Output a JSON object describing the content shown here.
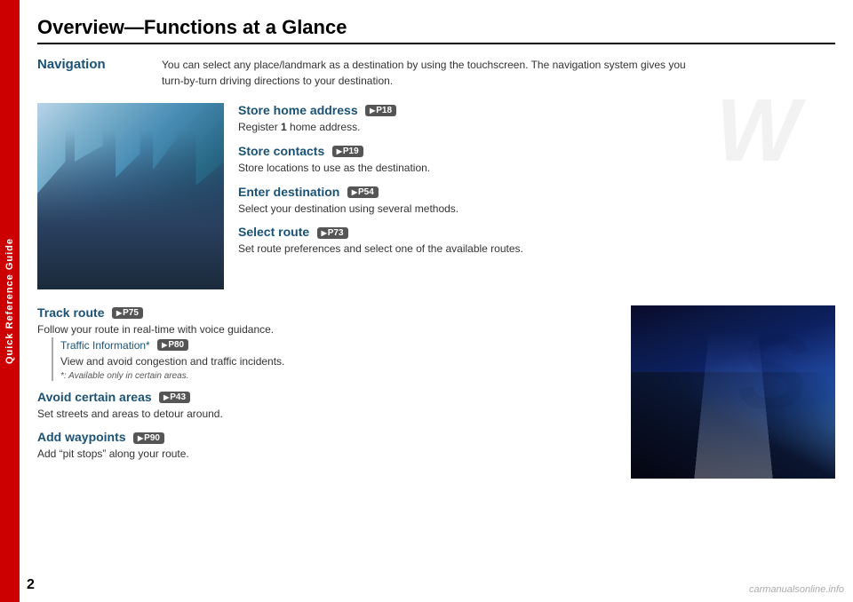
{
  "page": {
    "number": "2",
    "title": "Overview—Functions at a Glance",
    "watermark": "carmanualsonline.info"
  },
  "sidebar": {
    "label": "Quick Reference Guide"
  },
  "navigation": {
    "label": "Navigation",
    "description_line1": "You can select any place/landmark as a destination by using the touchscreen. The navigation system gives you",
    "description_line2": "turn-by-turn driving directions to your destination."
  },
  "upper_functions": [
    {
      "title": "Store home address",
      "page_ref": "P18",
      "description": "Register 1 home address."
    },
    {
      "title": "Store contacts",
      "page_ref": "P19",
      "description": "Store locations to use as the destination."
    },
    {
      "title": "Enter destination",
      "page_ref": "P54",
      "description": "Select your destination using several methods."
    },
    {
      "title": "Select route",
      "page_ref": "P73",
      "description": "Set route preferences and select one of the available routes."
    }
  ],
  "lower_functions": [
    {
      "title": "Track route",
      "page_ref": "P75",
      "description": "Follow your route in real-time with voice guidance.",
      "sub_item": {
        "title": "Traffic Information*",
        "page_ref": "P80",
        "description": "View and avoid congestion and traffic incidents.",
        "note": "*: Available only in certain areas."
      }
    },
    {
      "title": "Avoid certain areas",
      "page_ref": "P43",
      "description": "Set streets and areas to detour around."
    },
    {
      "title": "Add waypoints",
      "page_ref": "P90",
      "description": "Add “pit stops” along your route."
    }
  ]
}
